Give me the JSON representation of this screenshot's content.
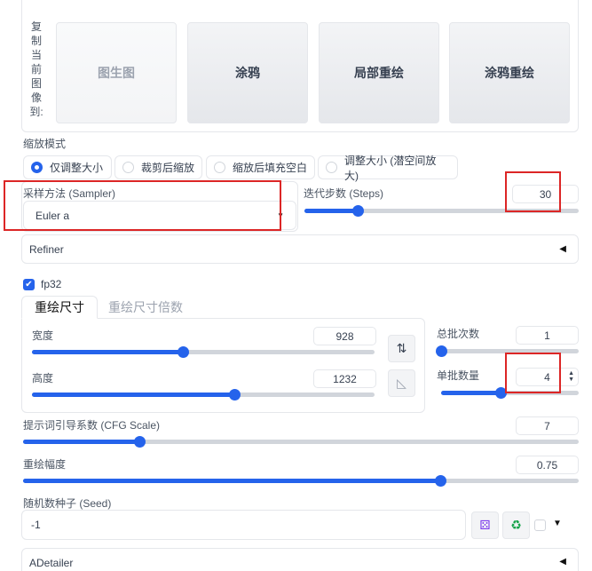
{
  "copy_to": {
    "label": "复制当前图像到:",
    "label_chars": [
      "复",
      "制",
      "当",
      "前",
      "图",
      "像",
      "到:"
    ],
    "buttons": [
      "图生图",
      "涂鸦",
      "局部重绘",
      "涂鸦重绘"
    ]
  },
  "resize_mode": {
    "label": "缩放模式",
    "options": [
      "仅调整大小",
      "裁剪后缩放",
      "缩放后填充空白",
      "调整大小 (潜空间放大)"
    ],
    "selected": "仅调整大小"
  },
  "sampler": {
    "label": "采样方法 (Sampler)",
    "value": "Euler a"
  },
  "steps": {
    "label": "迭代步数 (Steps)",
    "value": "30",
    "min": 1,
    "max": 150,
    "fraction": 0.195
  },
  "refiner": {
    "label": "Refiner"
  },
  "fp32": {
    "label": "fp32",
    "checked": true
  },
  "tabs": [
    "重绘尺寸",
    "重绘尺寸倍数"
  ],
  "width": {
    "label": "宽度",
    "value": "928",
    "fraction": 0.44
  },
  "height": {
    "label": "高度",
    "value": "1232",
    "fraction": 0.59
  },
  "swap_icon": "swap-vertical-icon",
  "ratio_icon": "triangle-ruler-icon",
  "batch_count": {
    "label": "总批次数",
    "value": "1",
    "fraction": 0.0
  },
  "batch_size": {
    "label": "单批数量",
    "value": "4",
    "fraction": 0.43
  },
  "cfg": {
    "label": "提示词引导系数 (CFG Scale)",
    "value": "7",
    "fraction": 0.21
  },
  "denoise": {
    "label": "重绘幅度",
    "value": "0.75",
    "fraction": 0.75
  },
  "seed": {
    "label": "随机数种子 (Seed)",
    "value": "-1"
  },
  "seed_icons": [
    "dice-icon",
    "recycle-icon"
  ],
  "adetailer": {
    "label": "ADetailer"
  },
  "colors": {
    "accent": "#2563eb",
    "highlight": "#dc2626"
  }
}
